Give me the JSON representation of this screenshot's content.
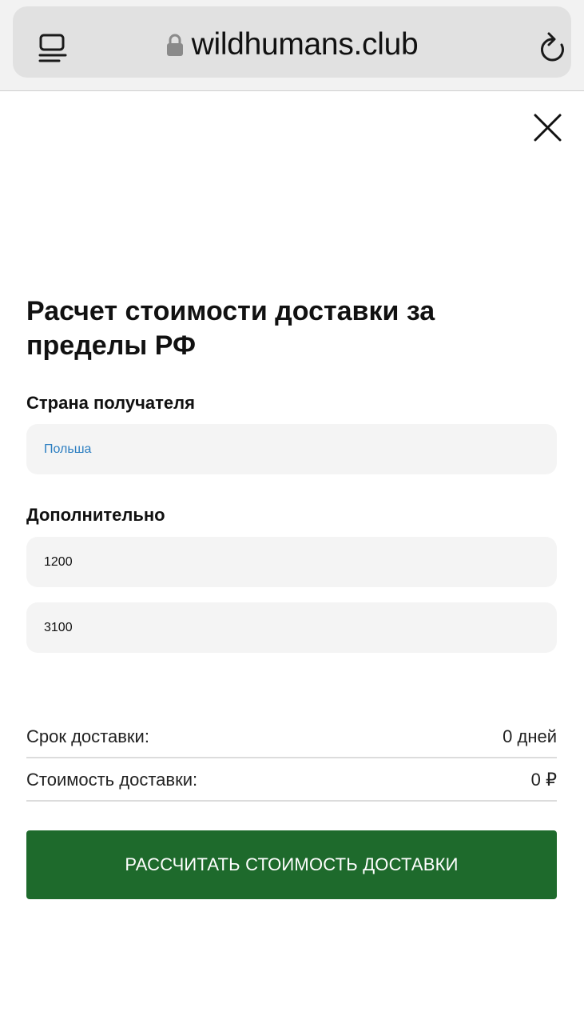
{
  "browser": {
    "url": "wildhumans.club",
    "icons": {
      "tabs": "tabs-icon",
      "lock": "lock-icon",
      "reload": "reload-icon"
    }
  },
  "modal": {
    "close_icon": "close-icon",
    "title": "Расчет стоимости доставки за пределы РФ",
    "country": {
      "label": "Страна получателя",
      "value": "Польша"
    },
    "additional": {
      "label": "Дополнительно",
      "fields": [
        {
          "value": "1200"
        },
        {
          "value": "3100"
        }
      ]
    },
    "results": [
      {
        "label": "Срок доставки:",
        "value": "0 дней"
      },
      {
        "label": "Стоимость доставки:",
        "value": "0 ₽"
      }
    ],
    "submit_label": "РАССЧИТАТЬ СТОИМОСТЬ ДОСТАВКИ"
  },
  "colors": {
    "accent_green": "#1e6a2c",
    "link_blue": "#2b7ec1",
    "field_bg": "#f4f4f4"
  }
}
